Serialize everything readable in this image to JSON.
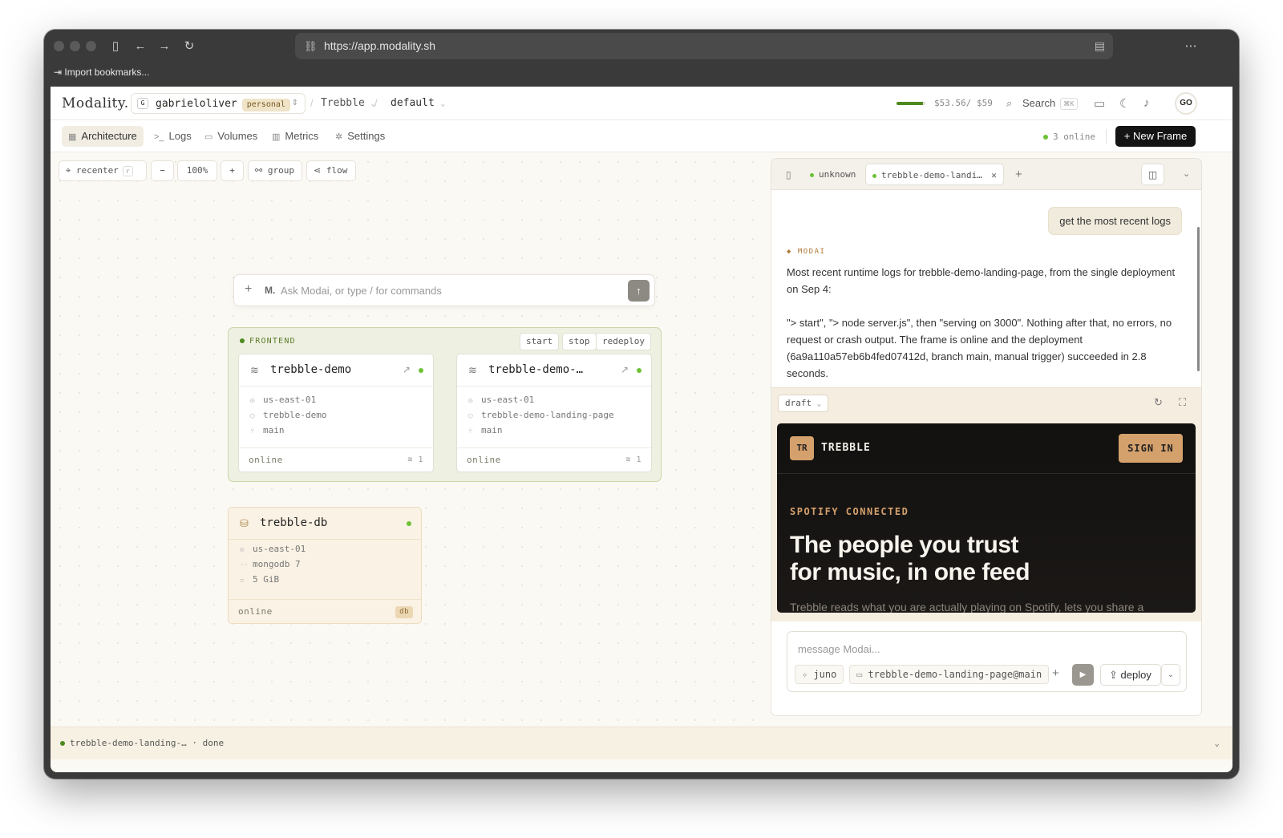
{
  "browser": {
    "url": "https://app.modality.sh",
    "bookmarks_label": "Import bookmarks..."
  },
  "topbar": {
    "logo": "Modality.",
    "org_initial": "G",
    "org_name": "gabrieloliver",
    "org_badge": "personal",
    "project": "Trebble",
    "environment": "default",
    "usage_text": "$53.56/ $59",
    "usage_fraction": 0.91,
    "search_label": "Search",
    "search_shortcut": "⌘K",
    "avatar_initials": "GO"
  },
  "nav": {
    "tabs": [
      {
        "label": "Architecture",
        "icon": "grid-icon"
      },
      {
        "label": "Logs",
        "icon": "terminal-icon"
      },
      {
        "label": "Volumes",
        "icon": "cylinder-icon"
      },
      {
        "label": "Metrics",
        "icon": "bar-chart-icon"
      },
      {
        "label": "Settings",
        "icon": "gear-icon"
      }
    ],
    "online_status": "3 online",
    "new_frame_label": "+ New Frame"
  },
  "canvas": {
    "toolbar": {
      "recenter": "recenter",
      "recenter_key": "r",
      "zoom": "100%",
      "group": "group",
      "flow": "flow"
    },
    "ask_placeholder": "Ask Modai, or type / for commands",
    "group": {
      "label": "FRONTEND",
      "actions": [
        "start",
        "stop",
        "redeploy"
      ]
    },
    "services": [
      {
        "name": "trebble-demo",
        "region": "us-east-01",
        "repo": "trebble-demo",
        "branch": "main",
        "status": "online",
        "replicas": "1"
      },
      {
        "name": "trebble-demo-…",
        "region": "us-east-01",
        "repo": "trebble-demo-landing-page",
        "branch": "main",
        "status": "online",
        "replicas": "1"
      }
    ],
    "database": {
      "name": "trebble-db",
      "region": "us-east-01",
      "engine": "mongodb 7",
      "size": "5 GiB",
      "status": "online",
      "tag": "db"
    }
  },
  "panel": {
    "tabs": [
      {
        "label": "unknown"
      },
      {
        "label": "trebble-demo-landi…"
      }
    ],
    "user_message": "get the most recent logs",
    "assistant_label": "MODAI",
    "assistant_paragraphs": [
      "Most recent runtime logs for trebble-demo-landing-page, from the single deployment on Sep 4:",
      "\"> start\", \"> node server.js\", then \"serving on 3000\". Nothing after that, no errors, no request or crash output. The frame is online and the deployment (6a9a110a57eb6b4fed07412d, branch main, manual trigger) succeeded in 2.8 seconds."
    ],
    "draft_label": "draft",
    "preview": {
      "logo_text": "TR",
      "brand": "TREBBLE",
      "sign_in": "SIGN IN",
      "kicker": "SPOTIFY CONNECTED",
      "headline_1": "The people you trust",
      "headline_2": "for music, in one feed",
      "subtext": "Trebble reads what you are actually playing on Spotify, lets you share a"
    },
    "compose": {
      "placeholder": "message Modai...",
      "model_chip": "juno",
      "context_chip": "trebble-demo-landing-page@main",
      "deploy_label": "deploy"
    }
  },
  "statusbar": {
    "text": "trebble-demo-landing-…",
    "state": "done"
  },
  "colors": {
    "accent_green": "#6cc234",
    "brand_tan": "#d4a06c",
    "primary_button": "#141414"
  }
}
